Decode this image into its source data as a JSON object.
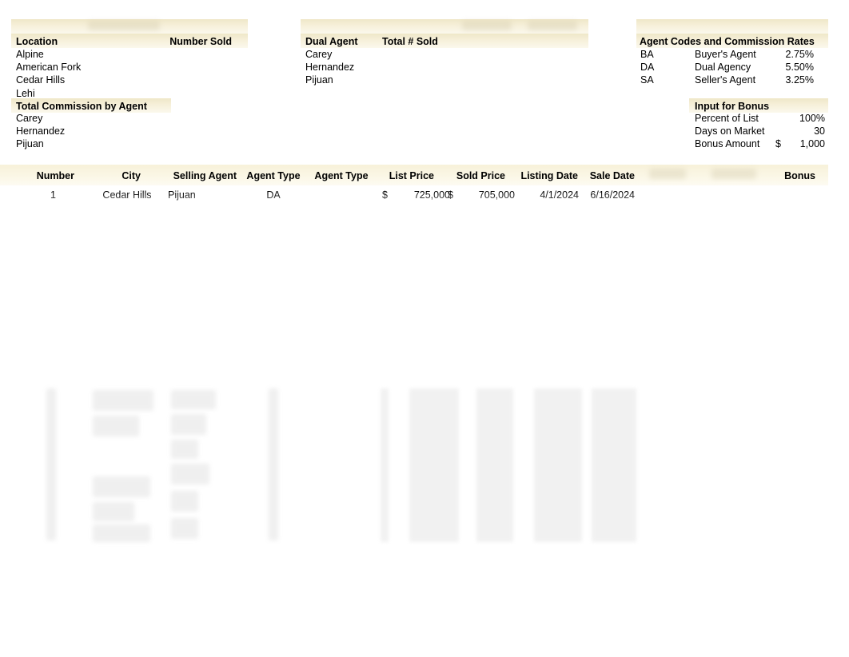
{
  "app": {
    "kind": "spreadsheet",
    "colors": {
      "header_band": "#f3ecd2",
      "sheet_band": "#faf5e4",
      "text": "#000000",
      "page": "#ffffff"
    }
  },
  "summary_location": {
    "title_obscured": true,
    "headers": [
      "Location",
      "Number Sold"
    ],
    "rows": [
      {
        "label": "Alpine",
        "value": ""
      },
      {
        "label": "American Fork",
        "value": ""
      },
      {
        "label": "Cedar Hills",
        "value": ""
      },
      {
        "label": "Lehi",
        "value": ""
      }
    ]
  },
  "summary_commission": {
    "title": "Total Commission by Agent",
    "rows": [
      {
        "label": "Carey",
        "value": ""
      },
      {
        "label": "Hernandez",
        "value": ""
      },
      {
        "label": "Pijuan",
        "value": ""
      }
    ]
  },
  "summary_dual_agent": {
    "headers": [
      "Dual Agent",
      "Total # Sold"
    ],
    "rows": [
      {
        "label": "Carey",
        "value": ""
      },
      {
        "label": "Hernandez",
        "value": ""
      },
      {
        "label": "Pijuan",
        "value": ""
      }
    ]
  },
  "agent_codes": {
    "title": "Agent Codes and Commission Rates",
    "rows": [
      {
        "code": "BA",
        "name": "Buyer's Agent",
        "rate": "2.75%"
      },
      {
        "code": "DA",
        "name": "Dual Agency",
        "rate": "5.50%"
      },
      {
        "code": "SA",
        "name": "Seller's Agent",
        "rate": "3.25%"
      }
    ]
  },
  "input_for_bonus": {
    "title": "Input for Bonus",
    "rows": [
      {
        "label": "Percent of List",
        "symbol": "",
        "value": "100%"
      },
      {
        "label": "Days on Market",
        "symbol": "",
        "value": "30"
      },
      {
        "label": "Bonus Amount",
        "symbol": "$",
        "value": "1,000"
      }
    ]
  },
  "main_table": {
    "headers": [
      "Number",
      "City",
      "Selling Agent",
      "Agent Type",
      "Agent Type",
      "List Price",
      "Sold Price",
      "Listing Date",
      "Sale Date",
      "",
      "",
      "Bonus"
    ],
    "rows": [
      {
        "number": "1",
        "city": "Cedar Hills",
        "selling_agent": "Pijuan",
        "agent_type_1": "DA",
        "agent_type_2": "",
        "list_price_symbol": "$",
        "list_price": "725,000",
        "sold_price_symbol": "$",
        "sold_price": "705,000",
        "listing_date": "4/1/2024",
        "sale_date": "6/16/2024",
        "col10": "",
        "col11": "",
        "bonus": ""
      }
    ]
  }
}
